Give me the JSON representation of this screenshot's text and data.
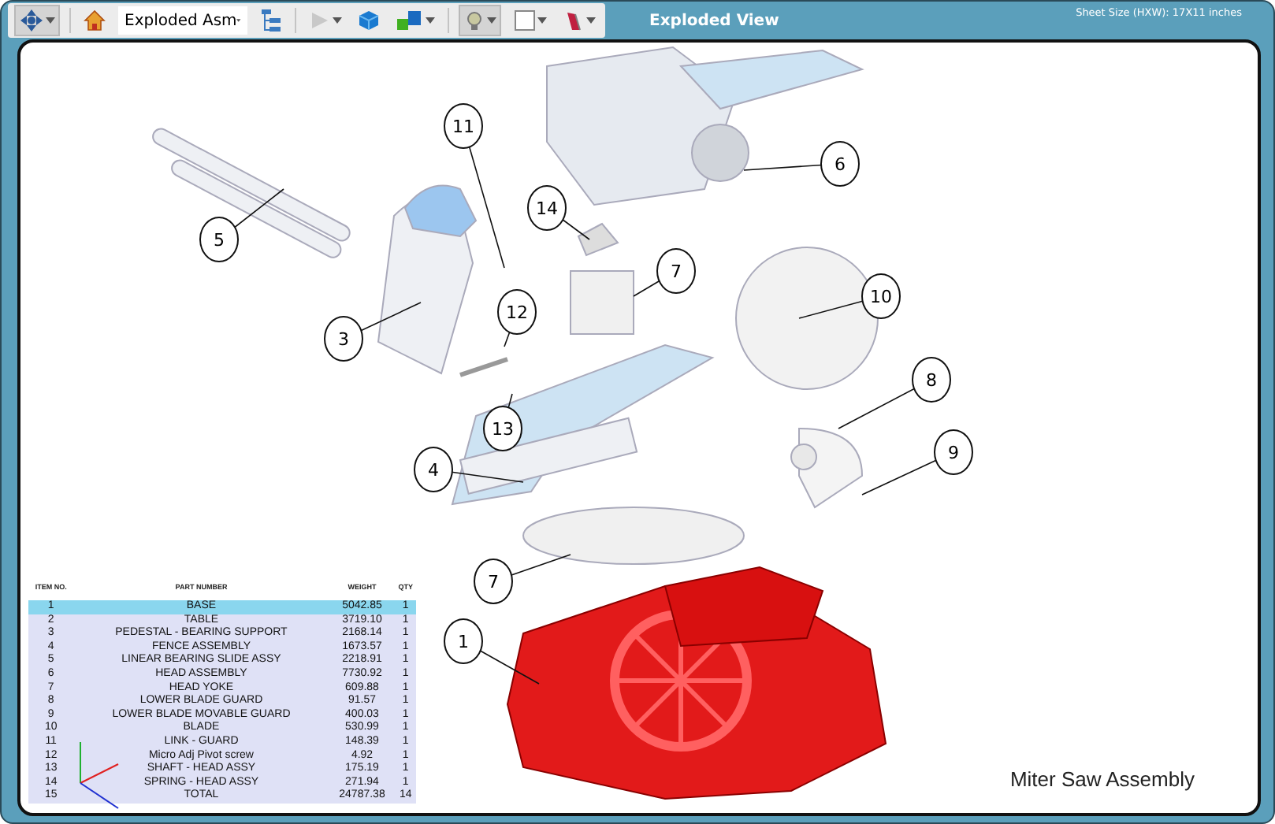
{
  "toolbar": {
    "view_select": "Exploded Asm",
    "title": "Exploded View",
    "sheet_size": "Sheet Size (HXW):  17X11 inches"
  },
  "balloons": [
    "11",
    "5",
    "14",
    "6",
    "7",
    "10",
    "12",
    "3",
    "13",
    "8",
    "9",
    "4",
    "7",
    "1"
  ],
  "bom": {
    "columns": [
      "ITEM NO.",
      "PART NUMBER",
      "WEIGHT",
      "QTY"
    ],
    "rows": [
      {
        "cells": [
          "1",
          "BASE",
          "5042.85",
          "1"
        ],
        "selected": true
      },
      {
        "cells": [
          "2",
          "TABLE",
          "3719.10",
          "1"
        ],
        "selected": false
      },
      {
        "cells": [
          "3",
          "PEDESTAL - BEARING SUPPORT",
          "2168.14",
          "1"
        ],
        "selected": false
      },
      {
        "cells": [
          "4",
          "FENCE ASSEMBLY",
          "1673.57",
          "1"
        ],
        "selected": false
      },
      {
        "cells": [
          "5",
          "LINEAR BEARING SLIDE ASSY",
          "2218.91",
          "1"
        ],
        "selected": false
      },
      {
        "cells": [
          "6",
          "HEAD ASSEMBLY",
          "7730.92",
          "1"
        ],
        "selected": false
      },
      {
        "cells": [
          "7",
          "HEAD YOKE",
          "609.88",
          "1"
        ],
        "selected": false
      },
      {
        "cells": [
          "8",
          "LOWER BLADE GUARD",
          "91.57",
          "1"
        ],
        "selected": false
      },
      {
        "cells": [
          "9",
          "LOWER BLADE MOVABLE GUARD",
          "400.03",
          "1"
        ],
        "selected": false
      },
      {
        "cells": [
          "10",
          "BLADE",
          "530.99",
          "1"
        ],
        "selected": false
      },
      {
        "cells": [
          "11",
          "LINK - GUARD",
          "148.39",
          "1"
        ],
        "selected": false
      },
      {
        "cells": [
          "12",
          "Micro Adj Pivot screw",
          "4.92",
          "1"
        ],
        "selected": false
      },
      {
        "cells": [
          "13",
          "SHAFT - HEAD ASSY",
          "175.19",
          "1"
        ],
        "selected": false
      },
      {
        "cells": [
          "14",
          "SPRING - HEAD ASSY",
          "271.94",
          "1"
        ],
        "selected": false
      },
      {
        "cells": [
          "15",
          "TOTAL",
          "24787.38",
          "14"
        ],
        "selected": false
      }
    ]
  },
  "drawing_title": "Miter Saw Assembly"
}
